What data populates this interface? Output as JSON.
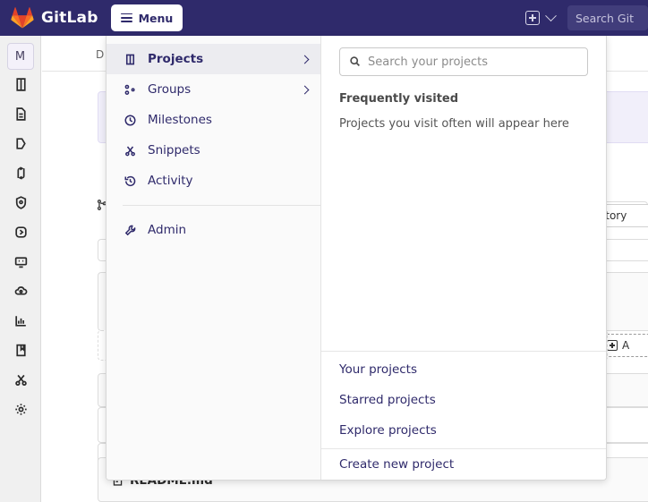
{
  "topbar": {
    "brand": "GitLab",
    "logo_icon": "gitlab-tanuki-icon",
    "menu_button": {
      "label": "Menu",
      "icon": "hamburger-icon"
    },
    "new_item": {
      "icon": "plus-square-icon",
      "chevron_icon": "chevron-down-icon"
    },
    "search": {
      "placeholder": "Search GitLab",
      "visible_text": "Search Git",
      "icon": "search-icon"
    },
    "background_color": "#2f2a6b"
  },
  "rail": {
    "avatar": {
      "initial": "M",
      "name": "project-avatar"
    },
    "items": [
      {
        "icon": "project-overview-icon",
        "name": "sidebar-item-project"
      },
      {
        "icon": "repository-file-icon",
        "name": "sidebar-item-repository"
      },
      {
        "icon": "issues-tag-icon",
        "name": "sidebar-item-issues"
      },
      {
        "icon": "merge-requests-icon",
        "name": "sidebar-item-merge-requests"
      },
      {
        "icon": "shield-security-icon",
        "name": "sidebar-item-security"
      },
      {
        "icon": "rocket-deploy-icon",
        "name": "sidebar-item-deployments"
      },
      {
        "icon": "monitor-icon",
        "name": "sidebar-item-monitor"
      },
      {
        "icon": "cloud-gear-icon",
        "name": "sidebar-item-infrastructure"
      },
      {
        "icon": "bar-chart-icon",
        "name": "sidebar-item-analytics"
      },
      {
        "icon": "book-wiki-icon",
        "name": "sidebar-item-wiki"
      },
      {
        "icon": "scissors-snippets-icon",
        "name": "sidebar-item-snippets"
      },
      {
        "icon": "gear-settings-icon",
        "name": "sidebar-item-settings"
      }
    ]
  },
  "page": {
    "breadcrumb": "D",
    "history_button": "History",
    "add_button": "A",
    "readme_filename": "README.md",
    "readme_icon": "file-doc-icon",
    "branch_icon": "branch-icon"
  },
  "dropdown": {
    "left": {
      "items": [
        {
          "label": "Projects",
          "icon": "projects-icon",
          "active": true,
          "has_chevron": true
        },
        {
          "label": "Groups",
          "icon": "groups-icon",
          "active": false,
          "has_chevron": true
        },
        {
          "label": "Milestones",
          "icon": "clock-icon",
          "active": false,
          "has_chevron": false
        },
        {
          "label": "Snippets",
          "icon": "scissors-icon",
          "active": false,
          "has_chevron": false
        },
        {
          "label": "Activity",
          "icon": "history-icon",
          "active": false,
          "has_chevron": false
        }
      ],
      "admin": {
        "label": "Admin",
        "icon": "wrench-icon"
      }
    },
    "right": {
      "search_placeholder": "Search your projects",
      "search_icon": "search-icon",
      "frequently_visited_title": "Frequently visited",
      "frequently_visited_empty": "Projects you visit often will appear here",
      "links": [
        {
          "label": "Your projects"
        },
        {
          "label": "Starred projects"
        },
        {
          "label": "Explore projects"
        }
      ],
      "create_link": {
        "label": "Create new project"
      }
    }
  },
  "colors": {
    "brand_navy": "#2f2a6b",
    "link_navy": "#2f2a6b",
    "rail_bg": "#f0f0f0",
    "dropdown_left_bg": "#fafafa",
    "active_item_bg": "#ececf0",
    "alert_bg": "#f1effa"
  }
}
